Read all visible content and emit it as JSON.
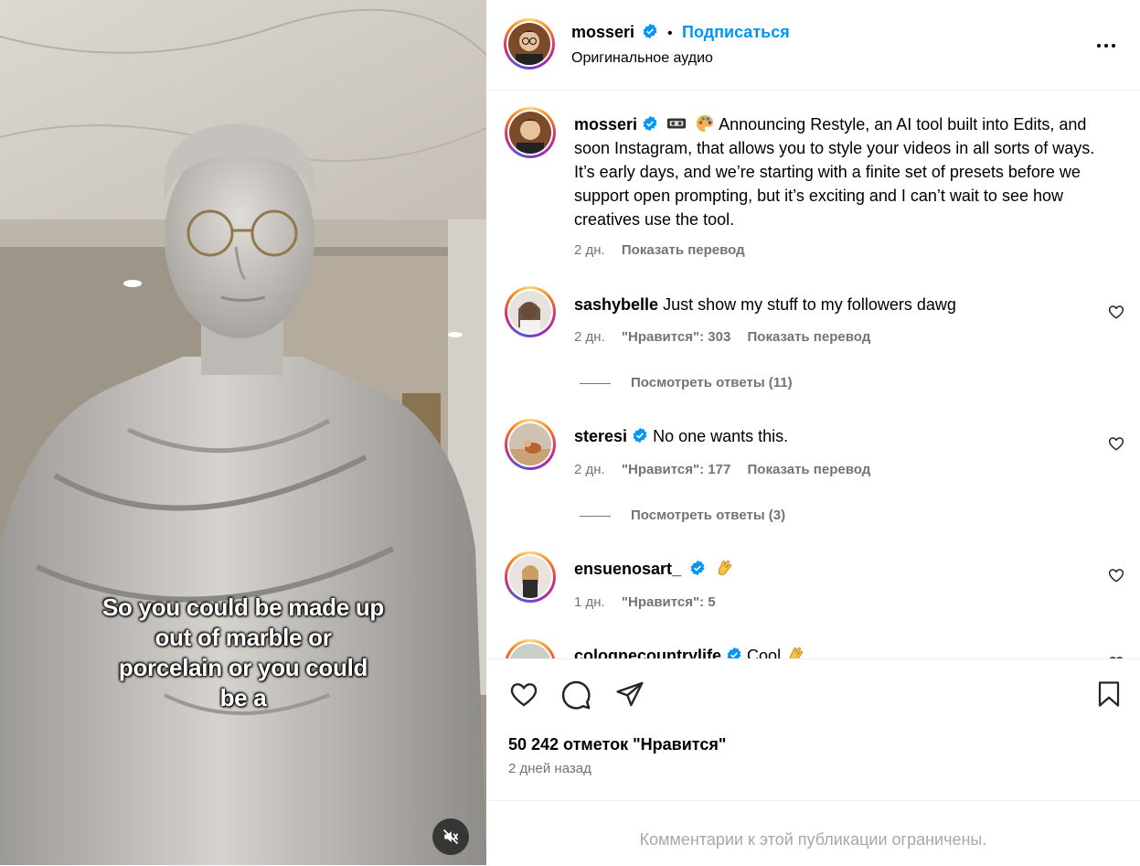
{
  "media": {
    "caption_lines": [
      "So you could be made up",
      "out of marble or",
      "porcelain or you could",
      "be a"
    ]
  },
  "header": {
    "username": "mosseri",
    "separator": "•",
    "follow_label": "Подписаться",
    "audio": "Оригинальное аудио"
  },
  "post": {
    "username": "mosseri",
    "text": "Announcing Restyle, an AI tool built into Edits, and soon Instagram, that allows you to style your videos in all sorts of ways. It’s early days, and we’re starting with a finite set of presets before we support open prompting, but it’s exciting and I can’t wait to see how creatives use the tool.",
    "time": "2 дн.",
    "translate": "Показать перевод"
  },
  "comments": [
    {
      "username": "sashybelle",
      "text": "Just show my stuff to my followers dawg",
      "time": "2 дн.",
      "likes": "\"Нравится\": 303",
      "translate": "Показать перевод",
      "replies": "Посмотреть ответы (11)"
    },
    {
      "username": "steresi",
      "text": "No one wants this.",
      "time": "2 дн.",
      "likes": "\"Нравится\": 177",
      "translate": "Показать перевод",
      "replies": "Посмотреть ответы (3)"
    },
    {
      "username": "ensuenosart_",
      "text": "",
      "time": "1 дн.",
      "likes": "\"Нравится\": 5"
    },
    {
      "username": "colognecountrylife",
      "text": "Cool"
    }
  ],
  "actions": {
    "likes": "50 242 отметок \"Нравится\"",
    "time": "2 дней назад"
  },
  "footer": {
    "notice": "Комментарии к этой публикации ограничены."
  },
  "colors": {
    "accent": "#0095f6",
    "secondary_text": "#737373",
    "verified": "#0095f6"
  },
  "icons": [
    "verified-badge-icon",
    "more-options-icon",
    "heart-icon",
    "comment-icon",
    "share-icon",
    "bookmark-icon",
    "mute-icon"
  ]
}
